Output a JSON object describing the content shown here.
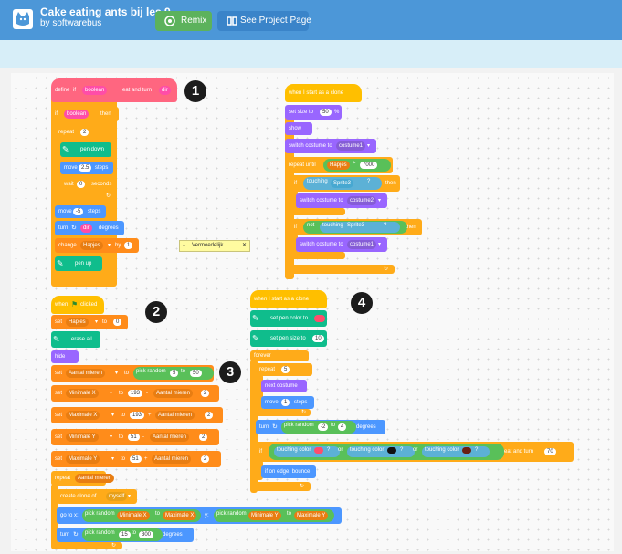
{
  "topbar": {
    "title": "Cake eating ants bij les 9",
    "author": "by softwarebus",
    "remix_label": "Remix",
    "project_page_label": "See Project Page"
  },
  "canvas": {
    "badges": [
      "1",
      "2",
      "3",
      "4"
    ],
    "script1": {
      "define": "define",
      "define_if": "if",
      "define_boolean": "boolean",
      "define_text": "eat and turn",
      "define_dir": "dir",
      "if": "if",
      "boolean": "boolean",
      "then": "then",
      "repeat": "repeat",
      "repeat_val": "2",
      "pen_down": "pen down",
      "move": "move",
      "move_val": "2.5",
      "steps": "steps",
      "wait": "wait",
      "wait_val": "0",
      "seconds": "seconds",
      "move2_val": "-5",
      "turn": "turn",
      "dir": "dir",
      "degrees": "degrees",
      "change": "change",
      "hapjes": "Hapjes",
      "by": "by",
      "by_val": "1",
      "pen_up": "pen up",
      "comment": "Vermoedelijk..."
    },
    "script2": {
      "when": "when",
      "clicked": "clicked",
      "set": "set",
      "hapjes": "Hapjes",
      "to": "to",
      "set_val": "0",
      "erase_all": "erase all",
      "hide": "hide",
      "aantal_mieren": "Aantal mieren",
      "pick_random": "pick random",
      "to_small": "to",
      "r1a": "5",
      "r1b": "50",
      "min_x": "Minimale X",
      "max_x": "Maximale X",
      "min_y": "Minimale Y",
      "max_y": "Maximale Y",
      "v193": "193",
      "v51": "51",
      "minus": "-",
      "plus": "+",
      "v2": "2",
      "repeat": "repeat",
      "create_clone": "create clone of",
      "myself": "myself",
      "go_to_x": "go to x:",
      "y": "y:",
      "turn": "turn",
      "r2a": "15",
      "r2b": "300",
      "degrees": "degrees"
    },
    "script3": {
      "hat": "when I start as a clone",
      "set_size": "set size to",
      "size_val": "50",
      "pct": "%",
      "show": "show",
      "switch_costume": "switch costume to",
      "costume1": "costume1",
      "costume2": "costume2",
      "repeat_until": "repeat until",
      "hapjes": "Hapjes",
      "gt": ">",
      "until_val": "7000",
      "if": "if",
      "touching": "touching",
      "sprite3": "Sprite3",
      "q": "?",
      "then": "then",
      "not": "not"
    },
    "script4": {
      "hat": "when I start as a clone",
      "set_pen_color": "set pen color to",
      "set_pen_size": "set pen size to",
      "size_val": "10",
      "forever": "forever",
      "repeat": "repeat",
      "repeat_val": "5",
      "next_costume": "next costume",
      "move": "move",
      "move_val": "1",
      "steps": "steps",
      "turn": "turn",
      "pick_random": "pick random",
      "to": "to",
      "ra": "-2",
      "rb": "4",
      "degrees": "degrees",
      "if": "if",
      "touching_color": "touching color",
      "or": "or",
      "q": "?",
      "eat_and_turn": "eat and turn",
      "eat_val": "70",
      "bounce": "if on edge, bounce"
    }
  },
  "colors": {
    "topbar": "#4c97d8",
    "events": "#ffbf00",
    "control": "#ffab19",
    "motion": "#4c97ff",
    "pen": "#0fbd8c",
    "variables": "#ff8c1a",
    "operators": "#59c059",
    "sensing": "#5cb1d6",
    "my_blocks": "#ff6680",
    "color_pink": "#ff4d6d",
    "color_black": "#111111",
    "color_brown": "#6a1f12"
  }
}
